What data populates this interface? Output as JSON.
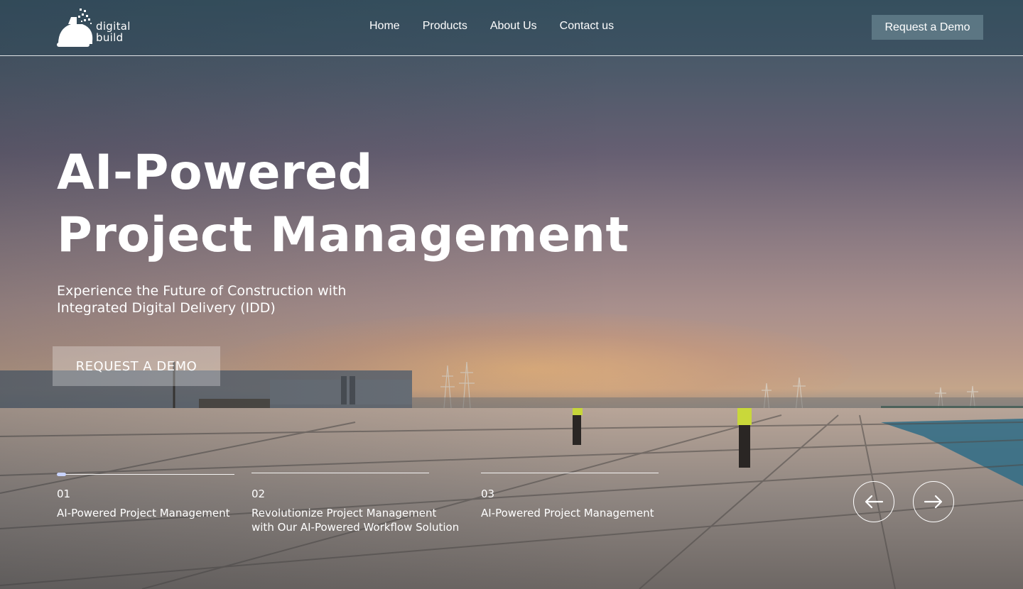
{
  "brand": {
    "name_line1": "digital",
    "name_line2": "build"
  },
  "nav": {
    "items": [
      "Home",
      "Products",
      "About Us",
      "Contact us"
    ]
  },
  "header": {
    "demo_button": "Request a Demo"
  },
  "hero": {
    "title_line1": "AI-Powered",
    "title_line2": "Project Management",
    "subtitle": "Experience the Future of Construction with Integrated Digital Delivery (IDD)",
    "cta": "REQUEST A DEMO"
  },
  "slides": [
    {
      "number": "01",
      "label": "AI-Powered Project Management",
      "progress": 0.05,
      "active": true
    },
    {
      "number": "02",
      "label": "Revolutionize Project Management\nwith Our AI-Powered Workflow Solution",
      "progress": 0,
      "active": false
    },
    {
      "number": "03",
      "label": "AI-Powered Project Management",
      "progress": 0,
      "active": false
    }
  ],
  "controls": {
    "prev_icon": "arrow-left-icon",
    "next_icon": "arrow-right-icon"
  },
  "colors": {
    "progress_fill": "#c9d4ff",
    "demo_button_bg": "#6f8e99"
  }
}
